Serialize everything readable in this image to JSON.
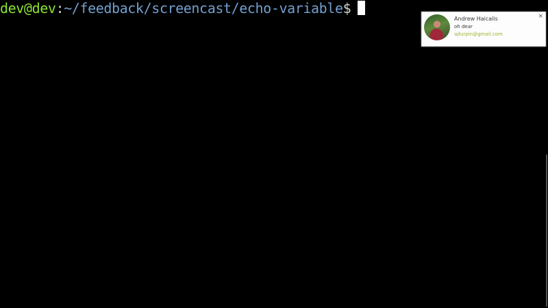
{
  "terminal": {
    "prompt_user_host": "dev@dev",
    "prompt_colon": ":",
    "prompt_path": "~/feedback/screencast/echo-variable",
    "prompt_symbol": "$",
    "colors": {
      "background": "#000000",
      "user_host": "#8ae234",
      "path": "#729fcf",
      "text": "#d3d7cf",
      "cursor": "#ffffff"
    }
  },
  "notification": {
    "sender_name": "Andrew Haicalis",
    "message": "oh dear",
    "email": "ajturpin@gmail.com",
    "close_label": "×",
    "email_color": "#99b030"
  }
}
